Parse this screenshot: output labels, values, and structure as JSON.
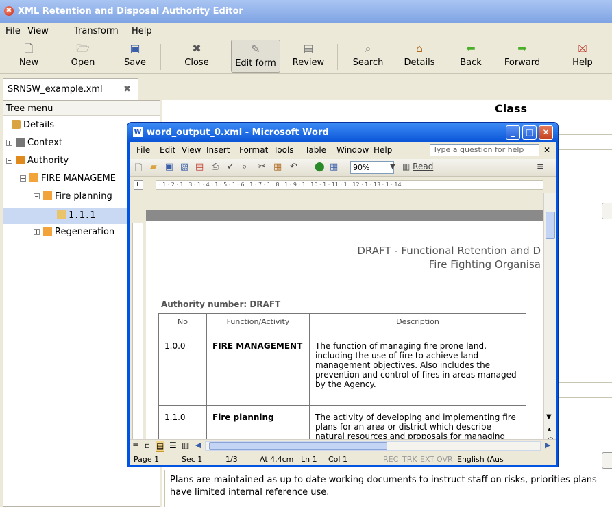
{
  "app": {
    "title": "XML Retention and Disposal Authority Editor",
    "menu": [
      "File",
      "View",
      "Transform",
      "Help"
    ],
    "toolbar": [
      {
        "label": "New",
        "icon": "new-doc-icon"
      },
      {
        "label": "Open",
        "icon": "folder-icon"
      },
      {
        "label": "Save",
        "icon": "save-icon"
      },
      {
        "label": "Close",
        "icon": "close-icon"
      },
      {
        "label": "Edit form",
        "icon": "edit-form-icon"
      },
      {
        "label": "Review",
        "icon": "review-icon"
      },
      {
        "label": "Search",
        "icon": "search-icon"
      },
      {
        "label": "Details",
        "icon": "home-icon"
      },
      {
        "label": "Back",
        "icon": "back-arrow-icon"
      },
      {
        "label": "Forward",
        "icon": "forward-arrow-icon"
      },
      {
        "label": "Help",
        "icon": "help-icon"
      }
    ],
    "tab": {
      "label": "SRNSW_example.xml"
    },
    "tree": {
      "header": "Tree menu",
      "items": [
        {
          "label": "Details"
        },
        {
          "label": "Context"
        },
        {
          "label": "Authority"
        },
        {
          "label": "FIRE MANAGEME"
        },
        {
          "label": "Fire planning"
        },
        {
          "label": "1.1.1"
        },
        {
          "label": "Regeneration"
        }
      ]
    },
    "editor": {
      "heading": "Class",
      "plans_text": "Plans are maintained as up to date working documents to instruct staff on risks, priorities plans have limited internal reference use."
    }
  },
  "word": {
    "title": "word_output_0.xml - Microsoft Word",
    "menu": [
      "File",
      "Edit",
      "View",
      "Insert",
      "Format",
      "Tools",
      "Table",
      "Window",
      "Help"
    ],
    "help_placeholder": "Type a question for help",
    "zoom": "90%",
    "read_label": "Read",
    "page": {
      "draft_line1": "DRAFT - Functional Retention and D",
      "draft_line2": "Fire Fighting Organisa",
      "authority_number": "Authority number: DRAFT",
      "table": {
        "headers": [
          "No",
          "Function/Activity",
          "Description"
        ],
        "rows": [
          {
            "no": "1.0.0",
            "function": "FIRE MANAGEMENT",
            "description": "The function of managing fire prone land, including the use of fire to achieve land management objectives. Also includes the prevention and control of fires in areas managed by the Agency."
          },
          {
            "no": "1.1.0",
            "function": "Fire planning",
            "description": "The activity of developing and implementing fire plans for an area or district which describe natural resources and proposals for managing fires."
          }
        ]
      }
    },
    "status": {
      "page": "Page 1",
      "sec": "Sec 1",
      "pages": "1/3",
      "at": "At 4.4cm",
      "ln": "Ln 1",
      "col": "Col 1",
      "rec": "REC",
      "trk": "TRK",
      "ext": "EXT",
      "ovr": "OVR",
      "lang": "English (Aus"
    }
  }
}
